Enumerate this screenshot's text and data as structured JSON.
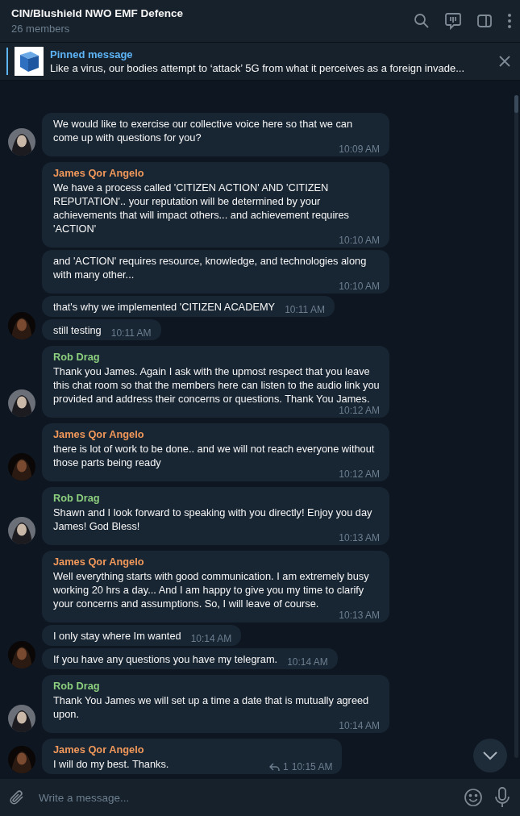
{
  "header": {
    "title": "CIN/Blushield NWO EMF Defence",
    "subtitle": "26 members"
  },
  "pinned": {
    "label": "Pinned message",
    "text": "Like a virus, our bodies attempt to ‘attack’ 5G from what it perceives as a foreign invade...",
    "thumbnail": {
      "kind": "picture"
    }
  },
  "groups": [
    {
      "avatar": {
        "kind": "picture"
      },
      "messages": [
        {
          "text": "We would like to exercise our collective voice here so that we can come up with questions for you?",
          "time": "10:09 AM"
        }
      ]
    },
    {
      "sender": "James Qor Angelo",
      "color": "#f0985a",
      "avatar": {
        "kind": "picture"
      },
      "messages": [
        {
          "text": "We have a process called 'CITIZEN ACTION' AND 'CITIZEN REPUTATION'.. your reputation will be determined by your achievements that will impact others... and achievement requires 'ACTION'",
          "time": "10:10 AM"
        },
        {
          "text": "and 'ACTION' requires resource, knowledge, and technologies along with many other...",
          "time": "10:10 AM"
        },
        {
          "text": "that's why we implemented 'CITIZEN ACADEMY",
          "time": "10:11 AM"
        },
        {
          "text": "still testing",
          "time": "10:11 AM"
        }
      ]
    },
    {
      "sender": "Rob Drag",
      "color": "#8ccf7e",
      "avatar": {
        "kind": "picture"
      },
      "messages": [
        {
          "text": "Thank you James. Again I ask with the upmost respect that you leave this chat room so that the members here can listen to the audio link you provided and address their concerns or questions. Thank You James.",
          "time": "10:12 AM"
        }
      ]
    },
    {
      "sender": "James Qor Angelo",
      "color": "#f0985a",
      "avatar": {
        "kind": "picture"
      },
      "messages": [
        {
          "text": "there is lot of work to be done.. and we will not reach everyone without those parts being ready",
          "time": "10:12 AM"
        }
      ]
    },
    {
      "sender": "Rob Drag",
      "color": "#8ccf7e",
      "avatar": {
        "kind": "picture"
      },
      "messages": [
        {
          "text": "Shawn and I look forward to speaking with you directly! Enjoy you day James! God Bless!",
          "time": "10:13 AM"
        }
      ]
    },
    {
      "sender": "James Qor Angelo",
      "color": "#f0985a",
      "avatar": {
        "kind": "picture"
      },
      "messages": [
        {
          "text": "Well everything starts with good communication. I am extremely busy working 20 hrs a day... And I am happy to give you my time to clarify your concerns and assumptions. So, I will leave of course.",
          "time": "10:13 AM"
        },
        {
          "text": "I only stay where Im wanted",
          "time": "10:14 AM"
        },
        {
          "text": "If you have any questions you have my telegram.",
          "time": "10:14 AM"
        }
      ]
    },
    {
      "sender": "Rob Drag",
      "color": "#8ccf7e",
      "avatar": {
        "kind": "picture"
      },
      "messages": [
        {
          "text": "Thank You James we will set up a time a date that is mutually agreed upon.",
          "time": "10:14 AM"
        }
      ]
    },
    {
      "sender": "James Qor Angelo",
      "color": "#f0985a",
      "avatar": {
        "kind": "picture"
      },
      "messages": [
        {
          "text": "I will do my best. Thanks.",
          "time": "10:15 AM",
          "replies": "1"
        }
      ]
    }
  ],
  "composer": {
    "placeholder": "Write a message..."
  }
}
